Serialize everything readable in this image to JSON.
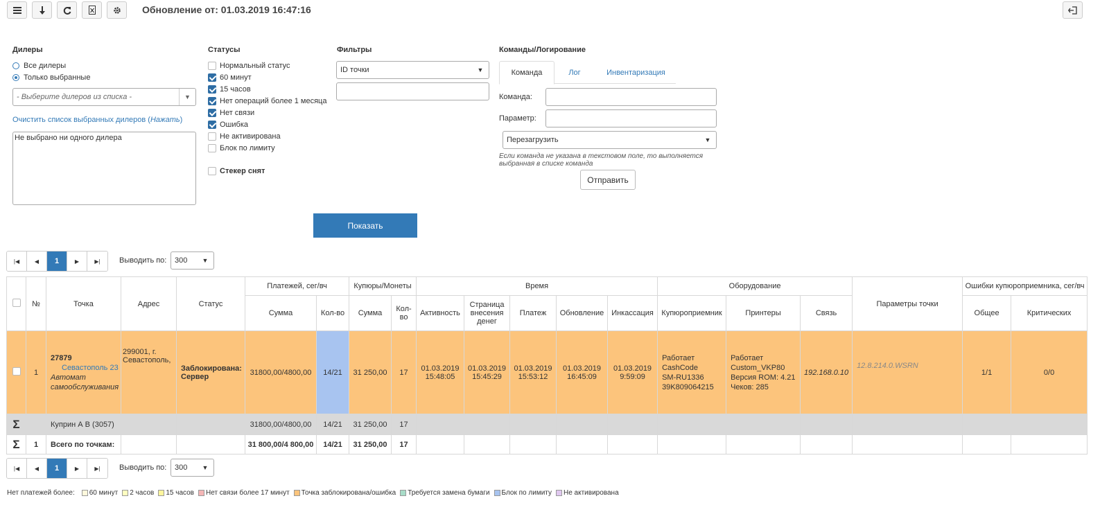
{
  "toolbar": {
    "buttons": [
      "menu-icon",
      "download-icon",
      "refresh-icon",
      "excel-icon",
      "gear-icon"
    ],
    "update_label": "Обновление от: 01.03.2019 16:47:16"
  },
  "dealers": {
    "title": "Дилеры",
    "radio_all": "Все дилеры",
    "radio_selected": "Только выбранные",
    "select_placeholder": "- Выберите дилеров из списка -",
    "clear_link": "Очистить список выбранных дилеров",
    "clear_link_hint": "Нажать",
    "list_text": "Не выбрано ни одного дилера"
  },
  "statuses": {
    "title": "Статусы",
    "items": [
      {
        "label": "Нормальный статус",
        "checked": false
      },
      {
        "label": "60 минут",
        "checked": true
      },
      {
        "label": "15 часов",
        "checked": true
      },
      {
        "label": "Нет операций более 1 месяца",
        "checked": true
      },
      {
        "label": "Нет связи",
        "checked": true
      },
      {
        "label": "Ошибка",
        "checked": true
      },
      {
        "label": "Не активирована",
        "checked": false
      },
      {
        "label": "Блок по лимиту",
        "checked": false
      }
    ],
    "sticker_label": "Стекер снят"
  },
  "filters": {
    "title": "Фильтры",
    "select_value": "ID точки",
    "input_value": ""
  },
  "commands": {
    "title": "Команды/Логирование",
    "tabs": [
      "Команда",
      "Лог",
      "Инвентаризация"
    ],
    "command_label": "Команда:",
    "param_label": "Параметр:",
    "select_value": "Перезагрузить",
    "hint": "Если команда не указана в текстовом поле, то выполняется выбранная в списке команда",
    "send_button": "Отправить"
  },
  "show_button": "Показать",
  "pager": {
    "current": "1",
    "per_page_label": "Выводить по:",
    "per_page": "300"
  },
  "table": {
    "headers": {
      "num": "№",
      "point": "Точка",
      "address": "Адрес",
      "status": "Статус",
      "payments": "Платежей, сег/вч",
      "notes": "Купюры/Монеты",
      "time": "Время",
      "equipment": "Оборудование",
      "params": "Параметры точки",
      "errors": "Ошибки купюроприемника, сег/вч",
      "sum": "Сумма",
      "count": "Кол-во",
      "sum2": "Сумма",
      "count2": "Кол-во",
      "activity": "Активность",
      "deposit_page": "Страница внесения денег",
      "payment": "Платеж",
      "update": "Обновление",
      "collection": "Инкассация",
      "acceptor": "Купюроприемник",
      "printers": "Принтеры",
      "link": "Связь",
      "err_total": "Общее",
      "err_critical": "Критических"
    },
    "row": {
      "num": "1",
      "point_id": "27879",
      "point_name": "Севастополь 23",
      "point_type": "Автомат самообслуживания",
      "address": "299001, г. Севастополь,",
      "status": "Заблокирована: Сервер",
      "pay_sum": "31800,00/4800,00",
      "pay_count": "14/21",
      "notes_sum": "31 250,00",
      "notes_count": "17",
      "activity": "01.03.2019 15:48:05",
      "deposit_page": "01.03.2019 15:45:29",
      "payment": "01.03.2019 15:53:12",
      "update": "01.03.2019 16:45:09",
      "collection": "01.03.2019 9:59:09",
      "acceptor": [
        "Работает",
        "CashCode",
        "SM-RU1336",
        "39K809064215"
      ],
      "printers": [
        "Работает",
        "Custom_VKP80",
        "Версия ROM: 4.21",
        "Чеков: 285"
      ],
      "link": "192.168.0.10",
      "params": "12.8.214.0.WSRN",
      "err_total": "1/1",
      "err_critical": "0/0"
    },
    "dealer_total": {
      "sigma": "Σ",
      "name": "Куприн А В (3057)",
      "pay_sum": "31800,00/4800,00",
      "pay_count": "14/21",
      "notes_sum": "31 250,00",
      "notes_count": "17"
    },
    "grand_total": {
      "sigma": "Σ",
      "num": "1",
      "name": "Всего по точкам:",
      "pay_sum": "31 800,00/4 800,00",
      "pay_count": "14/21",
      "notes_sum": "31 250,00",
      "notes_count": "17"
    }
  },
  "legend": {
    "prefix": "Нет платежей более:",
    "items": [
      {
        "label": "60 минут",
        "color": "#fff8dc"
      },
      {
        "label": "2 часов",
        "color": "#ffffc0"
      },
      {
        "label": "15 часов",
        "color": "#fff59d"
      },
      {
        "label": "Нет связи более 17 минут",
        "color": "#f4b6b6"
      },
      {
        "label": "Точка заблокирована/ошибка",
        "color": "#fcc47c"
      },
      {
        "label": "Требуется замена бумаги",
        "color": "#a8dcc8"
      },
      {
        "label": "Блок по лимиту",
        "color": "#a8c4f0"
      },
      {
        "label": "Не активирована",
        "color": "#e0c8f0"
      }
    ]
  },
  "colors": {
    "accent": "#337ab7",
    "row_blocked": "#fcc47c",
    "count_highlight": "#a8c4f0",
    "row_total": "#d9d9d9"
  }
}
